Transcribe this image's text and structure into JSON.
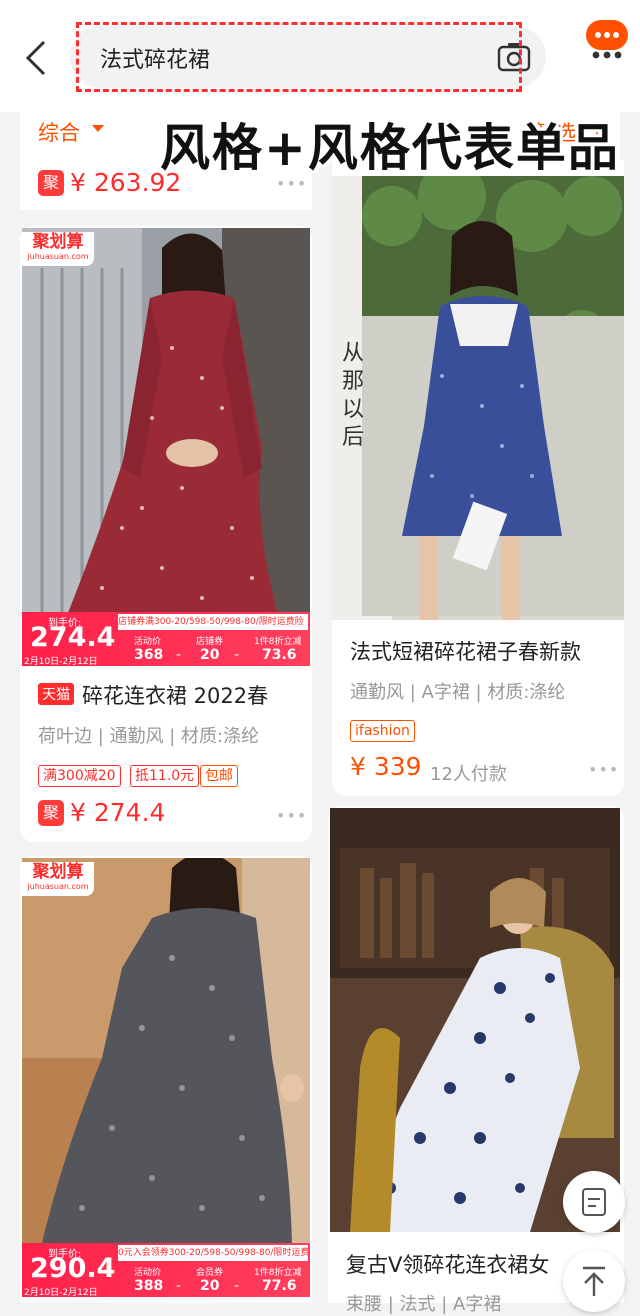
{
  "header": {
    "search_text": "法式碎花裙"
  },
  "sortbar": {
    "sort_label": "综合",
    "filter_label": "筛选"
  },
  "overlay_caption": "风格+风格代表单品",
  "top_partial": {
    "ju_badge": "聚",
    "price": "¥ 263.92"
  },
  "cards": {
    "left1": {
      "ju_banner": "聚划算",
      "ju_banner_sub": "juhuasuan.com",
      "strip_pre": "到手价:",
      "strip_price": "274.4",
      "strip_date": "2月10日-2月12日",
      "strip_promo": "店铺券满300-20/598-50/998-80/限时运费险",
      "strip_cols": [
        "活动价",
        "店铺券",
        "1件8折立减"
      ],
      "strip_vals": [
        "368",
        "-",
        "20",
        "-",
        "73.6"
      ],
      "store_tag": "天猫",
      "title": "碎花连衣裙 2022春",
      "attrs": "荷叶边 | 通勤风 | 材质:涤纶",
      "promos": [
        "满300减20",
        "抵11.0元",
        "包邮"
      ],
      "ju_badge": "聚",
      "price": "¥ 274.4"
    },
    "right1": {
      "photo_text": "从那以后",
      "title": "法式短裙碎花裙子春新款",
      "attrs": "通勤风 | A字裙 | 材质:涤纶",
      "brand_tag": "ifashion",
      "price": "¥ 339",
      "sold": "12人付款"
    },
    "left2": {
      "ju_banner": "聚划算",
      "ju_banner_sub": "juhuasuan.com",
      "strip_pre": "到手价:",
      "strip_price": "290.4",
      "strip_date": "2月10日-2月12日",
      "strip_promo": "0元入会领券300-20/598-50/998-80/限时运费险",
      "strip_cols": [
        "活动价",
        "会员券",
        "1件8折立减"
      ],
      "strip_vals": [
        "388",
        "-",
        "20",
        "-",
        "77.6"
      ]
    },
    "right2": {
      "title": "复古V领碎花连衣裙女",
      "attrs": "束腰 | 法式 | A字裙"
    }
  },
  "colors": {
    "accent": "#ff5000",
    "price_red": "#ff2c2c",
    "overlay_border": "#ff2d2d"
  }
}
